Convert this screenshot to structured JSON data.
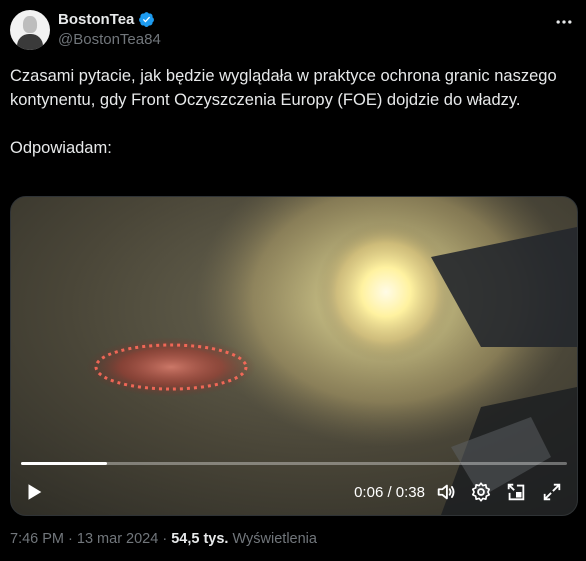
{
  "author": {
    "display_name": "BostonTea",
    "handle": "@BostonTea84",
    "verified": true
  },
  "tweet": {
    "text": "Czasami pytacie, jak będzie wyglądała w praktyce ochrona granic naszego kontynentu, gdy Front Oczyszczenia Europy (FOE) dojdzie do władzy.\n\nOdpowiadam:"
  },
  "video": {
    "time": "0:06 / 0:38",
    "progress": 0.158
  },
  "meta": {
    "time": "7:46 PM",
    "separator1": " · ",
    "date": "13 mar 2024",
    "separator2": " · ",
    "views_count": "54,5 tys.",
    "views_label": "Wyświetlenia"
  },
  "colors": {
    "background": "#000000",
    "text": "#e7e9ea",
    "secondary": "#71767b",
    "verified": "#1d9bf0"
  },
  "icons": [
    "more-icon",
    "verified-icon",
    "play-icon",
    "volume-icon",
    "settings-icon",
    "pip-icon",
    "fullscreen-icon"
  ]
}
